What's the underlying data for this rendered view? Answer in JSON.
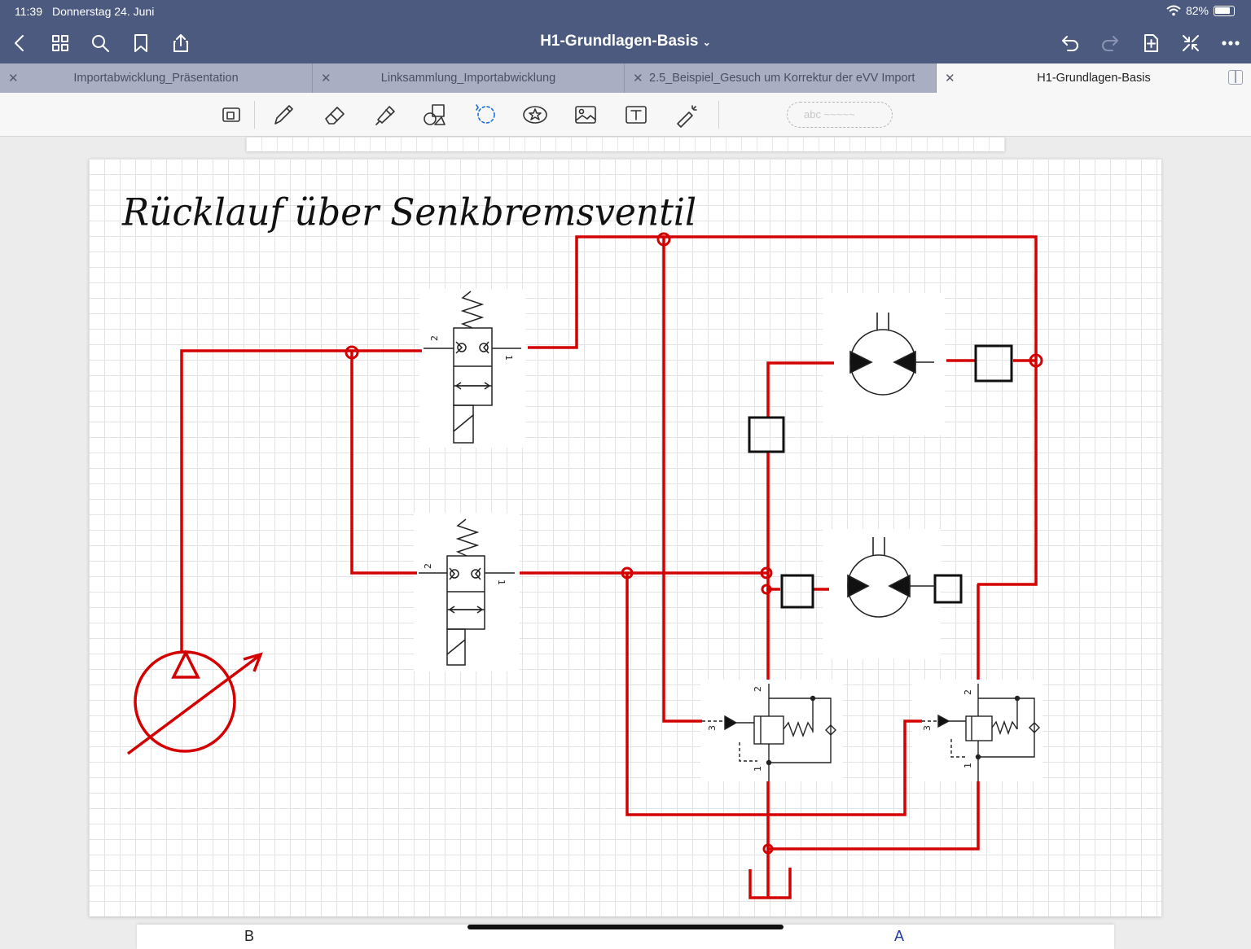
{
  "status": {
    "time": "11:39",
    "date": "Donnerstag 24. Juni",
    "battery": "82%"
  },
  "nav": {
    "title": "H1-Grundlagen-Basis"
  },
  "tabs": [
    {
      "label": "Importabwicklung_Präsentation"
    },
    {
      "label": "Linksammlung_Importabwicklung"
    },
    {
      "label": "2.5_Beispiel_Gesuch um Korrektur der eVV Import"
    },
    {
      "label": "H1-Grundlagen-Basis"
    }
  ],
  "toolbar": {
    "handwriting_placeholder": "abc ~~~~~"
  },
  "page": {
    "title": "Rücklauf über Senkbremsventil"
  },
  "diagram": {
    "port_labels": [
      "2",
      "1",
      "2",
      "1",
      "2",
      "3",
      "1",
      "2",
      "3",
      "1"
    ]
  },
  "next_page": {
    "left_text": "B",
    "right_text": "A"
  },
  "colors": {
    "line": "#d40000",
    "chrome": "#4d5a80",
    "tabbar": "#a9aec2"
  }
}
